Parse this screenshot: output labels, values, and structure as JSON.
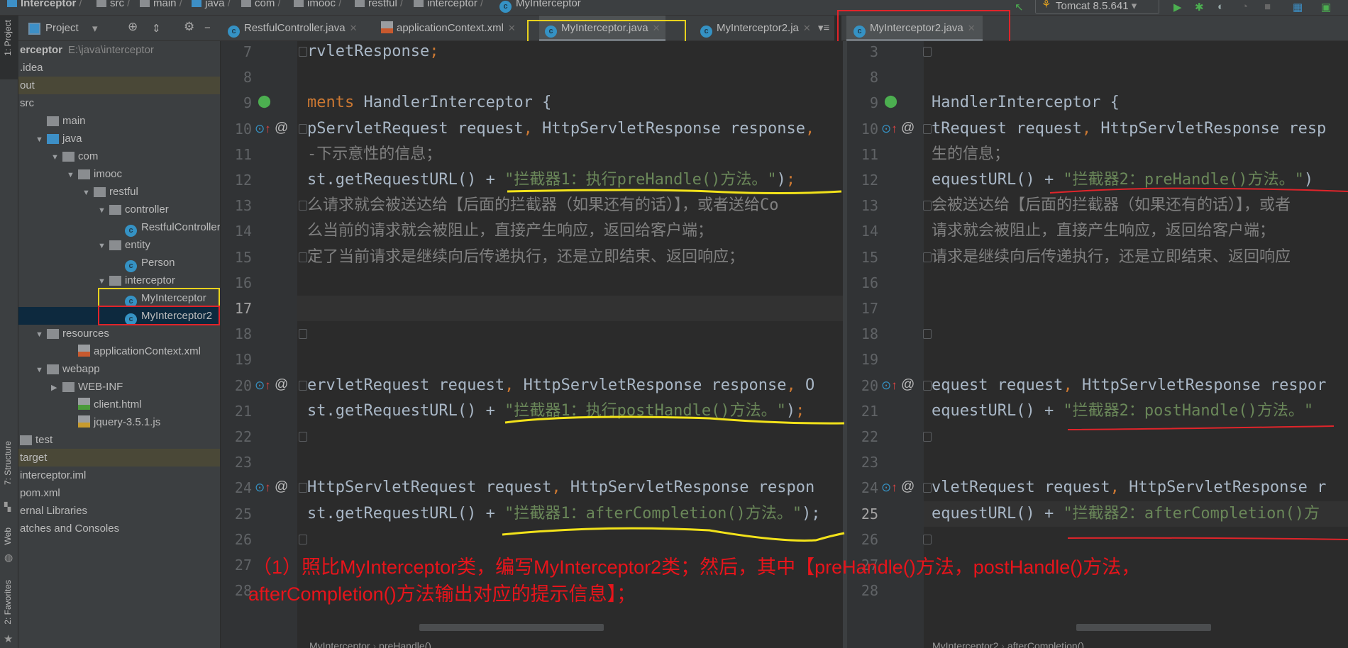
{
  "breadcrumb": [
    "Interceptor",
    "src",
    "main",
    "java",
    "com",
    "imooc",
    "restful",
    "interceptor",
    "MyInterceptor"
  ],
  "run_config": "Tomcat 8.5.641",
  "stripe": {
    "project": "1: Project",
    "structure": "7: Structure",
    "web": "Web",
    "favorites": "2: Favorites"
  },
  "project_panel": {
    "title": "Project"
  },
  "tree": [
    {
      "label": "erceptor",
      "extra": "E:\\java\\interceptor",
      "depth": 0,
      "type": "root"
    },
    {
      "label": ".idea",
      "depth": 0,
      "type": "plain"
    },
    {
      "label": "out",
      "depth": 0,
      "type": "plain",
      "hl": "tan"
    },
    {
      "label": "src",
      "depth": 0,
      "type": "plain"
    },
    {
      "label": "main",
      "depth": 1,
      "type": "folder"
    },
    {
      "label": "java",
      "depth": 1,
      "type": "srcfolder",
      "open": true
    },
    {
      "label": "com",
      "depth": 2,
      "type": "pkg",
      "open": true
    },
    {
      "label": "imooc",
      "depth": 3,
      "type": "pkg",
      "open": true
    },
    {
      "label": "restful",
      "depth": 4,
      "type": "pkg",
      "open": true
    },
    {
      "label": "controller",
      "depth": 5,
      "type": "pkg",
      "open": true
    },
    {
      "label": "RestfulController",
      "depth": 6,
      "type": "class"
    },
    {
      "label": "entity",
      "depth": 5,
      "type": "pkg",
      "open": true
    },
    {
      "label": "Person",
      "depth": 6,
      "type": "class"
    },
    {
      "label": "interceptor",
      "depth": 5,
      "type": "pkg",
      "open": true
    },
    {
      "label": "MyInterceptor",
      "depth": 6,
      "type": "class",
      "box": "#e8d21d"
    },
    {
      "label": "MyInterceptor2",
      "depth": 6,
      "type": "class",
      "hl": "sel",
      "box": "#e0242a"
    },
    {
      "label": "resources",
      "depth": 1,
      "type": "res",
      "open": true
    },
    {
      "label": "applicationContext.xml",
      "depth": 3,
      "type": "xml"
    },
    {
      "label": "webapp",
      "depth": 1,
      "type": "web",
      "open": true
    },
    {
      "label": "WEB-INF",
      "depth": 2,
      "type": "folder",
      "closed": true
    },
    {
      "label": "client.html",
      "depth": 3,
      "type": "html"
    },
    {
      "label": "jquery-3.5.1.js",
      "depth": 3,
      "type": "js"
    },
    {
      "label": "test",
      "depth": 0,
      "type": "folder"
    },
    {
      "label": "target",
      "depth": 0,
      "type": "plain",
      "hl": "tan"
    },
    {
      "label": "interceptor.iml",
      "depth": 0,
      "type": "plain"
    },
    {
      "label": "pom.xml",
      "depth": 0,
      "type": "plain"
    },
    {
      "label": "ernal Libraries",
      "depth": 0,
      "type": "plain"
    },
    {
      "label": "atches and Consoles",
      "depth": 0,
      "type": "plain"
    }
  ],
  "tabs": [
    {
      "label": "RestfulController.java",
      "icon": "class"
    },
    {
      "label": "applicationContext.xml",
      "icon": "xml"
    },
    {
      "label": "MyInterceptor.java",
      "icon": "class",
      "active": true
    },
    {
      "label": "MyInterceptor2.ja",
      "icon": "class"
    }
  ],
  "right_tab": {
    "label": "MyInterceptor2.java",
    "icon": "class"
  },
  "left_editor": {
    "lines": [
      {
        "n": "7",
        "segs": [
          {
            "t": "rvletResponse",
            "k": ""
          },
          {
            "t": ";",
            "k": "kw"
          }
        ]
      },
      {
        "n": "8",
        "segs": []
      },
      {
        "n": "9",
        "segs": [
          {
            "t": "ments ",
            "k": "kw"
          },
          {
            "t": "HandlerInterceptor {",
            "k": ""
          }
        ]
      },
      {
        "n": "10",
        "segs": [
          {
            "t": "pServletRequest request",
            "k": ""
          },
          {
            "t": ", ",
            "k": "kw"
          },
          {
            "t": "HttpServletResponse response",
            "k": ""
          },
          {
            "t": ",",
            "k": "kw"
          }
        ]
      },
      {
        "n": "11",
        "segs": [
          {
            "t": "-下示意性的信息；",
            "k": "cm"
          }
        ]
      },
      {
        "n": "12",
        "segs": [
          {
            "t": "st.getRequestURL() + ",
            "k": ""
          },
          {
            "t": "\"拦截器1：执行preHandle()方法。\"",
            "k": "str"
          },
          {
            "t": ")",
            "k": ""
          },
          {
            "t": ";",
            "k": "kw"
          }
        ]
      },
      {
        "n": "13",
        "segs": [
          {
            "t": "么请求就会被送达给【后面的拦截器（如果还有的话）】，或者送给Co",
            "k": "cm"
          }
        ]
      },
      {
        "n": "14",
        "segs": [
          {
            "t": "么当前的请求就会被阻止，直接产生响应，返回给客户端；",
            "k": "cm"
          }
        ]
      },
      {
        "n": "15",
        "segs": [
          {
            "t": "定了当前请求是继续向后传递执行，还是立即结束、返回响应；",
            "k": "cm"
          }
        ]
      },
      {
        "n": "16",
        "segs": []
      },
      {
        "n": "17",
        "segs": []
      },
      {
        "n": "18",
        "segs": []
      },
      {
        "n": "19",
        "segs": []
      },
      {
        "n": "20",
        "segs": [
          {
            "t": "ervletRequest request",
            "k": ""
          },
          {
            "t": ", ",
            "k": "kw"
          },
          {
            "t": "HttpServletResponse response",
            "k": ""
          },
          {
            "t": ", ",
            "k": "kw"
          },
          {
            "t": "O",
            "k": ""
          }
        ]
      },
      {
        "n": "21",
        "segs": [
          {
            "t": "st.getRequestURL() + ",
            "k": ""
          },
          {
            "t": "\"拦截器1：执行postHandle()方法。\"",
            "k": "str"
          },
          {
            "t": ")",
            "k": ""
          },
          {
            "t": ";",
            "k": "kw"
          }
        ]
      },
      {
        "n": "22",
        "segs": []
      },
      {
        "n": "23",
        "segs": []
      },
      {
        "n": "24",
        "segs": [
          {
            "t": "HttpServletRequest request",
            "k": ""
          },
          {
            "t": ", ",
            "k": "kw"
          },
          {
            "t": "HttpServletResponse respon",
            "k": ""
          }
        ]
      },
      {
        "n": "25",
        "segs": [
          {
            "t": "st.getRequestURL() + ",
            "k": ""
          },
          {
            "t": "\"拦截器1：afterCompletion()方法。\"",
            "k": "str"
          },
          {
            "t": ");",
            "k": ""
          }
        ]
      },
      {
        "n": "26",
        "segs": []
      },
      {
        "n": "27",
        "segs": []
      },
      {
        "n": "28",
        "segs": []
      }
    ],
    "breadcrumb": [
      "MyInterceptor",
      "preHandle()"
    ]
  },
  "right_editor": {
    "lines": [
      {
        "n": "3",
        "segs": []
      },
      {
        "n": "8",
        "segs": []
      },
      {
        "n": "9",
        "segs": [
          {
            "t": "HandlerInterceptor {",
            "k": ""
          }
        ]
      },
      {
        "n": "10",
        "segs": [
          {
            "t": "tRequest request",
            "k": ""
          },
          {
            "t": ", ",
            "k": "kw"
          },
          {
            "t": "HttpServletResponse resp",
            "k": ""
          }
        ]
      },
      {
        "n": "11",
        "segs": [
          {
            "t": "生的信息；",
            "k": "cm"
          }
        ]
      },
      {
        "n": "12",
        "segs": [
          {
            "t": "equestURL() + ",
            "k": ""
          },
          {
            "t": "\"拦截器2：preHandle()方法。\"",
            "k": "str"
          },
          {
            "t": ")",
            "k": ""
          }
        ]
      },
      {
        "n": "13",
        "segs": [
          {
            "t": "会被送达给【后面的拦截器（如果还有的话）】，或者",
            "k": "cm"
          }
        ]
      },
      {
        "n": "14",
        "segs": [
          {
            "t": "请求就会被阻止，直接产生响应，返回给客户端；",
            "k": "cm"
          }
        ]
      },
      {
        "n": "15",
        "segs": [
          {
            "t": "请求是继续向后传递执行，还是立即结束、返回响应",
            "k": "cm"
          }
        ]
      },
      {
        "n": "16",
        "segs": []
      },
      {
        "n": "17",
        "segs": []
      },
      {
        "n": "18",
        "segs": []
      },
      {
        "n": "19",
        "segs": []
      },
      {
        "n": "20",
        "segs": [
          {
            "t": "equest request",
            "k": ""
          },
          {
            "t": ", ",
            "k": "kw"
          },
          {
            "t": "HttpServletResponse respor",
            "k": ""
          }
        ]
      },
      {
        "n": "21",
        "segs": [
          {
            "t": "equestURL() + ",
            "k": ""
          },
          {
            "t": "\"拦截器2：postHandle()方法。\"",
            "k": "str"
          }
        ]
      },
      {
        "n": "22",
        "segs": []
      },
      {
        "n": "23",
        "segs": []
      },
      {
        "n": "24",
        "segs": [
          {
            "t": "vletRequest request",
            "k": ""
          },
          {
            "t": ", ",
            "k": "kw"
          },
          {
            "t": "HttpServletResponse r",
            "k": ""
          }
        ]
      },
      {
        "n": "25",
        "segs": [
          {
            "t": "equestURL() + ",
            "k": ""
          },
          {
            "t": "\"拦截器2：afterCompletion()方",
            "k": "str"
          }
        ]
      },
      {
        "n": "26",
        "segs": []
      },
      {
        "n": "27",
        "segs": []
      },
      {
        "n": "28",
        "segs": []
      }
    ],
    "breadcrumb": [
      "MyInterceptor2",
      "afterCompletion()"
    ]
  },
  "annotation": {
    "line1": "（1）照比MyInterceptor类，编写MyInterceptor2类；然后，其中【preHandle()方法，postHandle()方法，",
    "line2": "afterCompletion()方法输出对应的提示信息】；"
  },
  "colors": {
    "highlight_yellow": "#f2e21a",
    "highlight_red": "#e0242a",
    "annotation": "#e8141b",
    "selection": "#0d293e"
  }
}
